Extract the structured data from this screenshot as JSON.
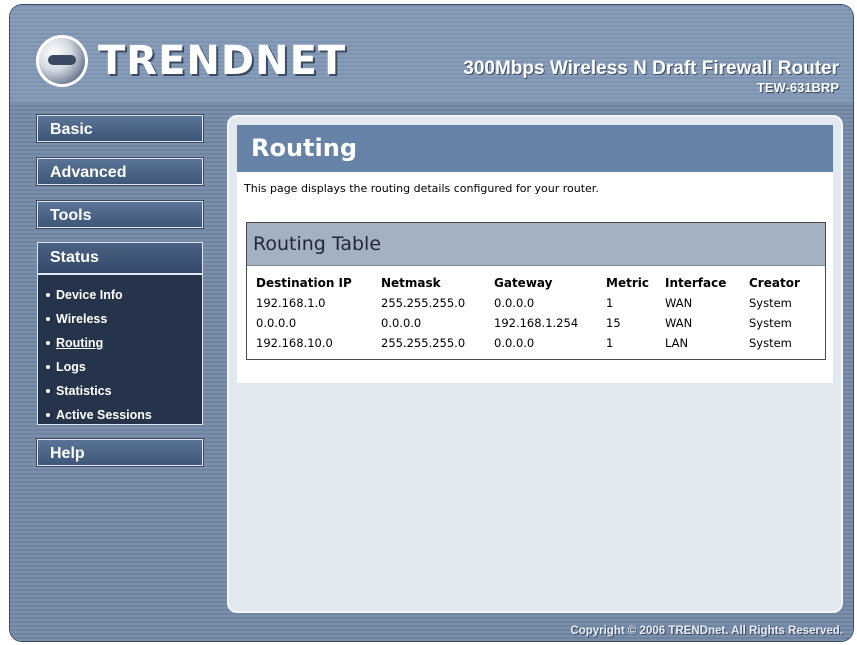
{
  "header": {
    "logo_text": "TRENDNET",
    "product_title": "300Mbps Wireless N Draft Firewall Router",
    "model": "TEW-631BRP"
  },
  "nav": {
    "basic": "Basic",
    "advanced": "Advanced",
    "tools": "Tools",
    "status": "Status",
    "help": "Help",
    "status_items": [
      {
        "label": "Device Info"
      },
      {
        "label": "Wireless"
      },
      {
        "label": "Routing"
      },
      {
        "label": "Logs"
      },
      {
        "label": "Statistics"
      },
      {
        "label": "Active Sessions"
      }
    ]
  },
  "main": {
    "title": "Routing",
    "description": "This page displays the routing details configured for your router.",
    "table_title": "Routing Table",
    "columns": [
      "Destination IP",
      "Netmask",
      "Gateway",
      "Metric",
      "Interface",
      "Creator"
    ],
    "rows": [
      [
        "192.168.1.0",
        "255.255.255.0",
        "0.0.0.0",
        "1",
        "WAN",
        "System"
      ],
      [
        "0.0.0.0",
        "0.0.0.0",
        "192.168.1.254",
        "15",
        "WAN",
        "System"
      ],
      [
        "192.168.10.0",
        "255.255.255.0",
        "0.0.0.0",
        "1",
        "LAN",
        "System"
      ]
    ]
  },
  "footer": {
    "copyright": "Copyright © 2006 TRENDnet. All Rights Reserved."
  },
  "colors": {
    "header_bg": "#7d93b0",
    "title_bar": "#6682a6",
    "table_head": "#a3b1c2",
    "nav_panel": "#25344a"
  }
}
